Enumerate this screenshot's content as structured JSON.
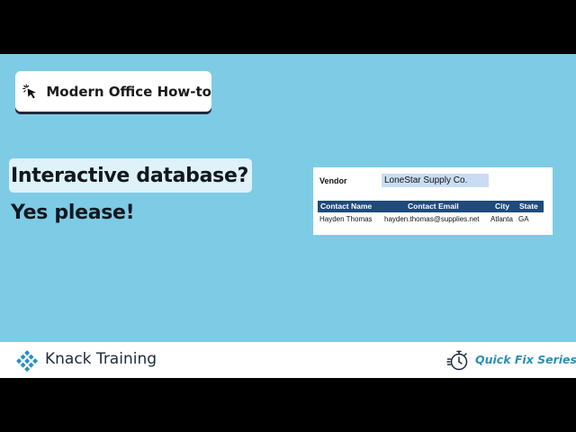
{
  "badge": {
    "label": "Modern Office How-to",
    "icon": "cursor-click-icon"
  },
  "headline": {
    "line1": "Interactive database?",
    "line2": "Yes please!"
  },
  "sheet": {
    "vendor_label": "Vendor",
    "vendor_value": "LoneStar Supply Co.",
    "columns": [
      "Contact Name",
      "Contact Email",
      "City",
      "State"
    ],
    "rows": [
      [
        "Hayden Thomas",
        "hayden.thomas@supplies.net",
        "Atlanta",
        "GA"
      ]
    ]
  },
  "footer": {
    "brand": "Knack Training",
    "brand_icon": "knack-diamond-logo",
    "series": "Quick Fix Series",
    "series_icon": "stopwatch-icon"
  },
  "colors": {
    "background": "#7ecbe6",
    "table_header": "#1f4a7a",
    "vendor_highlight": "#c9dcf2",
    "series_text": "#2a8fb8",
    "brand_text": "#1e2a3a"
  }
}
